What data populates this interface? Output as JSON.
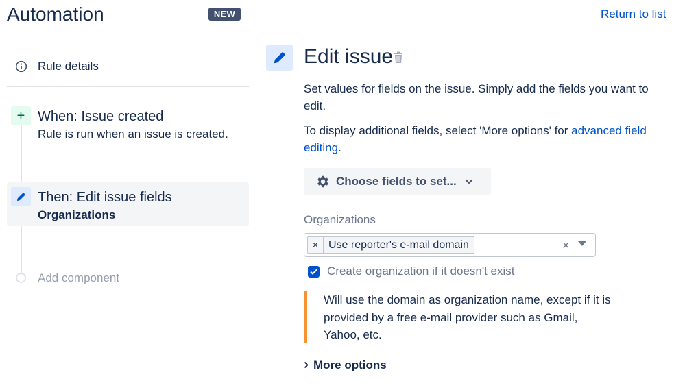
{
  "header": {
    "title": "Automation",
    "badge": "NEW",
    "return_link": "Return to list"
  },
  "sidebar": {
    "rule_details_label": "Rule details",
    "trigger": {
      "icon": "plus-icon",
      "title": "When: Issue created",
      "description": "Rule is run when an issue is created."
    },
    "action": {
      "icon": "pencil-icon",
      "title": "Then: Edit issue fields",
      "subtitle": "Organizations"
    },
    "add_component_label": "Add component"
  },
  "main": {
    "title": "Edit issue",
    "description": "Set values for fields on the issue. Simply add the fields you want to edit.",
    "more_fields_prefix": "To display additional fields, select 'More options' for ",
    "more_fields_link": "advanced field editing",
    "more_fields_suffix": ".",
    "choose_fields_button": "Choose fields to set...",
    "organizations_label": "Organizations",
    "organizations_selected": "Use reporter's e-mail domain",
    "checkbox_label": "Create organization if it doesn't exist",
    "checkbox_checked": true,
    "info_text": "Will use the domain as organization name, except if it is provided by a free e-mail provider such as Gmail, Yahoo, etc.",
    "more_options_label": "More options"
  },
  "colors": {
    "primary": "#0052cc",
    "text": "#172b4d",
    "badge_bg": "#42526e",
    "warning_accent": "#f79232",
    "trigger_bg": "#e3fcef",
    "action_bg": "#deebff"
  }
}
